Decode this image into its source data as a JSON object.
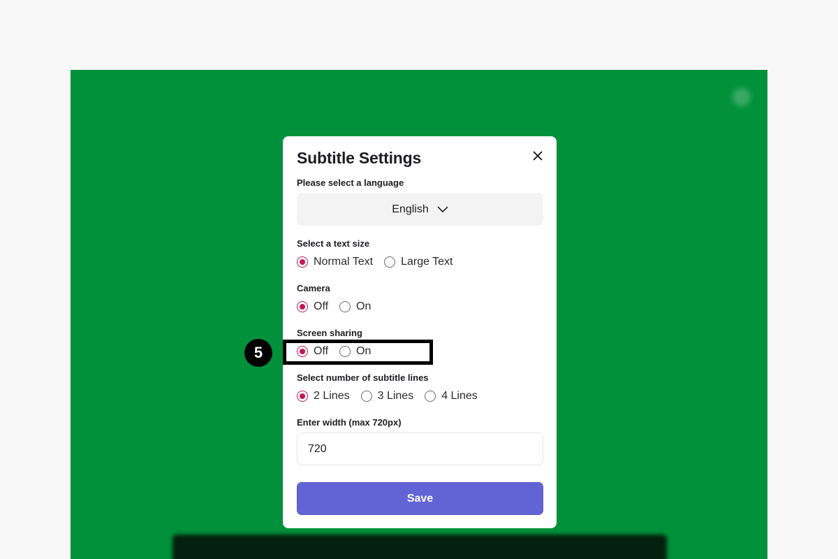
{
  "modal": {
    "title": "Subtitle Settings",
    "language_label": "Please select a language",
    "language_value": "English",
    "text_size": {
      "label": "Select a text size",
      "options": [
        "Normal Text",
        "Large Text"
      ],
      "selected": "Normal Text"
    },
    "camera": {
      "label": "Camera",
      "options": [
        "Off",
        "On"
      ],
      "selected": "Off"
    },
    "screen_sharing": {
      "label": "Screen sharing",
      "options": [
        "Off",
        "On"
      ],
      "selected": "Off"
    },
    "subtitle_lines": {
      "label": "Select number of subtitle lines",
      "options": [
        "2 Lines",
        "3 Lines",
        "4 Lines"
      ],
      "selected": "2 Lines"
    },
    "width": {
      "label": "Enter width (max 720px)",
      "value": "720"
    },
    "save_label": "Save"
  },
  "annotation": {
    "step_number": "5"
  },
  "colors": {
    "background": "#00913a",
    "accent_radio": "#c2185b",
    "save_button": "#6264d6"
  },
  "icons": {
    "close": "close-icon",
    "dropdown": "chevron-down-icon"
  }
}
